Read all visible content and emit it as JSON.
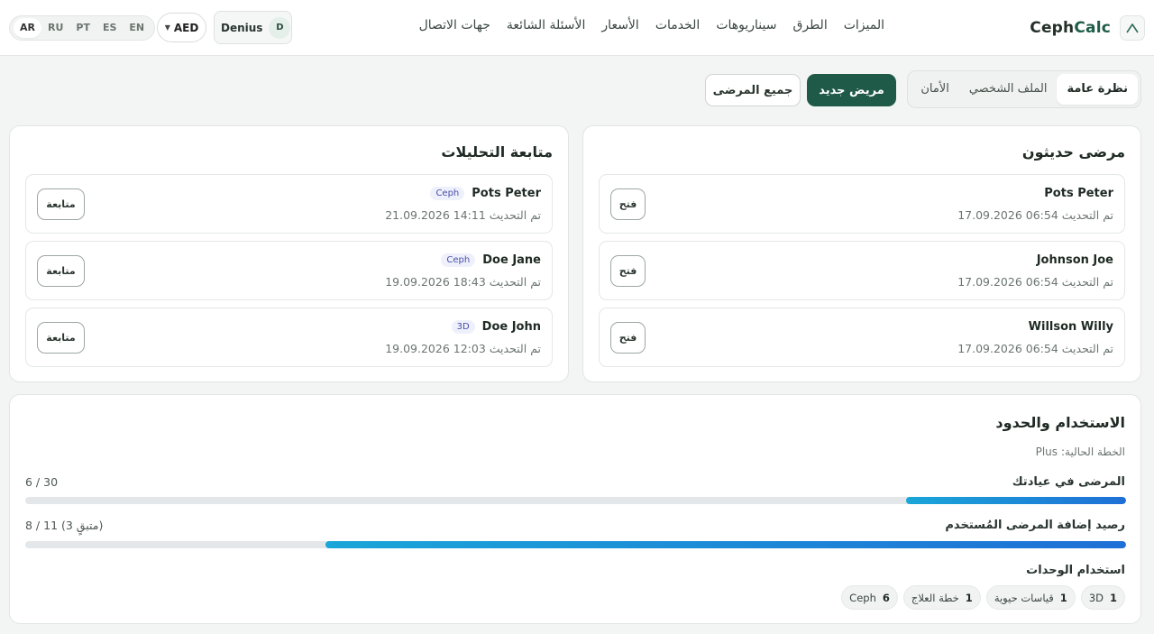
{
  "header": {
    "brand": {
      "prefix": "Ceph",
      "suffix": "Calc"
    },
    "nav": [
      "الميزات",
      "الطرق",
      "سيناريوهات",
      "الخدمات",
      "الأسعار",
      "الأسئلة الشائعة",
      "جهات الاتصال"
    ],
    "languages": [
      "AR",
      "RU",
      "PT",
      "ES",
      "EN"
    ],
    "active_language": "AR",
    "currency": "AED",
    "user": {
      "name": "Denius",
      "initial": "D"
    }
  },
  "tabs": [
    "نظرة عامة",
    "الملف الشخصي",
    "الأمان"
  ],
  "active_tab": "نظرة عامة",
  "actions": {
    "new_patient": "مريض جديد",
    "all_patients": "جميع المرضى"
  },
  "recent": {
    "title": "مرضى حديثون",
    "button_label": "فتح",
    "updated_label": "تم التحديث",
    "rows": [
      {
        "name": "Pots Peter",
        "date": "17.09.2026 06:54"
      },
      {
        "name": "Johnson Joe",
        "date": "17.09.2026 06:54"
      },
      {
        "name": "Willson Willy",
        "date": "17.09.2026 06:54"
      }
    ]
  },
  "followup": {
    "title": "متابعة التحليلات",
    "button_label": "متابعة",
    "updated_label": "تم التحديث",
    "rows": [
      {
        "name": "Pots Peter",
        "tag": "Ceph",
        "date": "21.09.2026 14:11"
      },
      {
        "name": "Doe Jane",
        "tag": "Ceph",
        "date": "19.09.2026 18:43"
      },
      {
        "name": "Doe John",
        "tag": "3D",
        "date": "19.09.2026 12:03"
      }
    ]
  },
  "usage": {
    "title": "الاستخدام والحدود",
    "plan_label": "الخطة الحالية:",
    "plan": "Plus",
    "metrics": [
      {
        "label": "المرضى في عيادتك",
        "value": "6 / 30",
        "progress": 0.2
      },
      {
        "label": "رصيد إضافة المرضى المُستخدم",
        "value": "8 / 11 (متبقٍ 3)",
        "progress": 0.727
      }
    ],
    "units_label": "استخدام الوحدات",
    "units": [
      {
        "name": "3D",
        "count": "1"
      },
      {
        "name": "قياسات حيوية",
        "count": "1"
      },
      {
        "name": "خطة العلاج",
        "count": "1"
      },
      {
        "name": "Ceph",
        "count": "6"
      }
    ]
  }
}
